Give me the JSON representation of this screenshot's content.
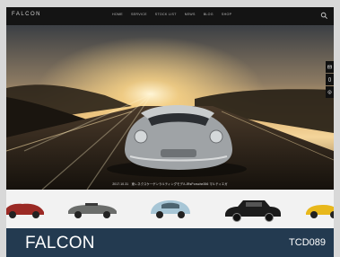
{
  "nav": {
    "brand": "FALCON",
    "menu": [
      "HOME",
      "SERVICE",
      "STOCK LIST",
      "NEWS",
      "BLOG",
      "SHOP"
    ]
  },
  "hero": {
    "caption": "2017.10.31　東レネクスケーゲンラルティングモデルJRsPorsche356 マルティエガ"
  },
  "sidetabs": [
    "mail-icon",
    "phone-icon",
    "info-icon"
  ],
  "thumbnails": [
    {
      "name": "red-classic-car",
      "color": "#9b2a25"
    },
    {
      "name": "gray-vintage-roadster",
      "color": "#6b6d6b"
    },
    {
      "name": "light-blue-beetle",
      "color": "#a7c6d6"
    },
    {
      "name": "black-classic-sedan",
      "color": "#1c1c1c"
    },
    {
      "name": "yellow-sports-car",
      "color": "#e8b81c"
    }
  ],
  "footer": {
    "title": "FALCON",
    "code": "TCD089"
  },
  "colors": {
    "nav_bg": "#141414",
    "footer_bg": "#233a50",
    "strip_bg": "#f2f2f2"
  }
}
